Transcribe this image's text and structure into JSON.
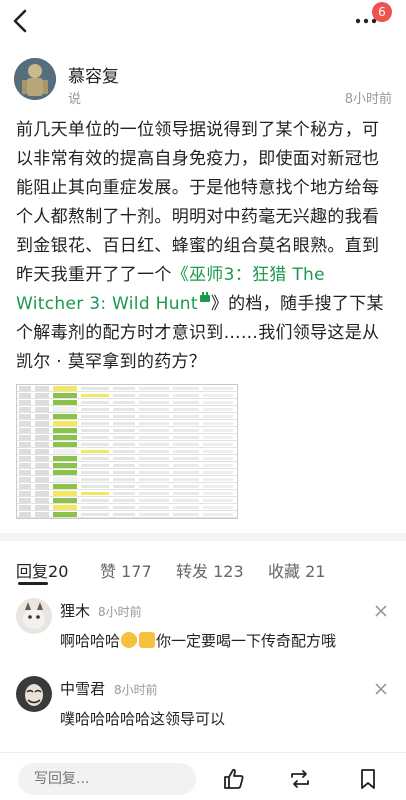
{
  "topbar": {
    "notification_count": "6",
    "back_icon": "chevron-left-icon",
    "more_icon": "more-dots-icon"
  },
  "post": {
    "author": "慕容复",
    "type": "说",
    "time": "8小时前",
    "body_before_link": "前几天单位的一位领导据说得到了某个秘方，可以非常有效的提高自身免疫力，即使面对新冠也能阻止其向重症发展。于是他特意找个地方给每个人都熬制了十剂。明明对中药毫无兴趣的我看到金银花、百日红、蜂蜜的组合莫名眼熟。直到昨天我重开了了一个",
    "link_text": "《巫师3：狂猎 The Witcher 3: Wild Hunt",
    "body_after_link": "》的档，随手搜了下某个解毒剂的配方时才意识到……我们领导这是从凯尔 · 莫罕拿到的药方？"
  },
  "tabs": [
    {
      "label": "回复",
      "count": "20"
    },
    {
      "label": "赞",
      "count": "177"
    },
    {
      "label": "转发",
      "count": "123"
    },
    {
      "label": "收藏",
      "count": "21"
    }
  ],
  "comments": [
    {
      "name": "狸木",
      "time": "8小时前",
      "text_before_emoji": "啊哈哈哈",
      "text_after_emoji": "你一定要喝一下传奇配方哦"
    },
    {
      "name": "中雪君",
      "time": "8小时前",
      "text": "噗哈哈哈哈哈这领导可以"
    }
  ],
  "bottombar": {
    "reply_placeholder": "写回复..."
  },
  "colors": {
    "link": "#1a9a4b",
    "badge": "#f0534f",
    "sheet_green": "#8bc34a",
    "sheet_yellow": "#f5e663"
  }
}
